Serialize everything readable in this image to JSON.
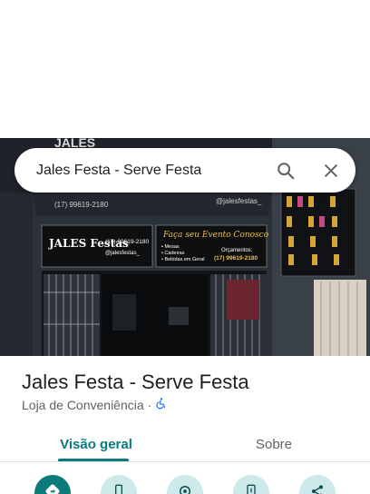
{
  "search": {
    "query": "Jales Festa - Serve Festa"
  },
  "place": {
    "title": "Jales Festa - Serve Festa",
    "category": "Loja de Conveniência",
    "separator": "·"
  },
  "tabs": [
    {
      "label": "Visão geral",
      "active": true
    },
    {
      "label": "Sobre",
      "active": false
    }
  ],
  "actions": [
    {
      "icon": "directions-icon"
    },
    {
      "icon": "phone-icon"
    },
    {
      "icon": "location-icon"
    },
    {
      "icon": "save-to-phone-icon"
    },
    {
      "icon": "share-icon"
    }
  ],
  "photo": {
    "sign_brand": "JALES Festas",
    "sign_phone": "(17) 99619-2180",
    "sign_instagram": "@jalesfestas_",
    "sign_headline": "Faça seu Evento Conosco",
    "sign_items": [
      "• Mesas",
      "• Cadeiras",
      "• Bebidas em Geral"
    ],
    "sign_orcamentos": "Orçamentos:",
    "awning_phone": "(17) 99619-2180",
    "awning_instagram": "@jalesfestas_",
    "top_brand": "JALES"
  },
  "colors": {
    "accent": "#0b7a7a",
    "accent_light": "#cde9ea",
    "sign_gold": "#e8c24a"
  }
}
